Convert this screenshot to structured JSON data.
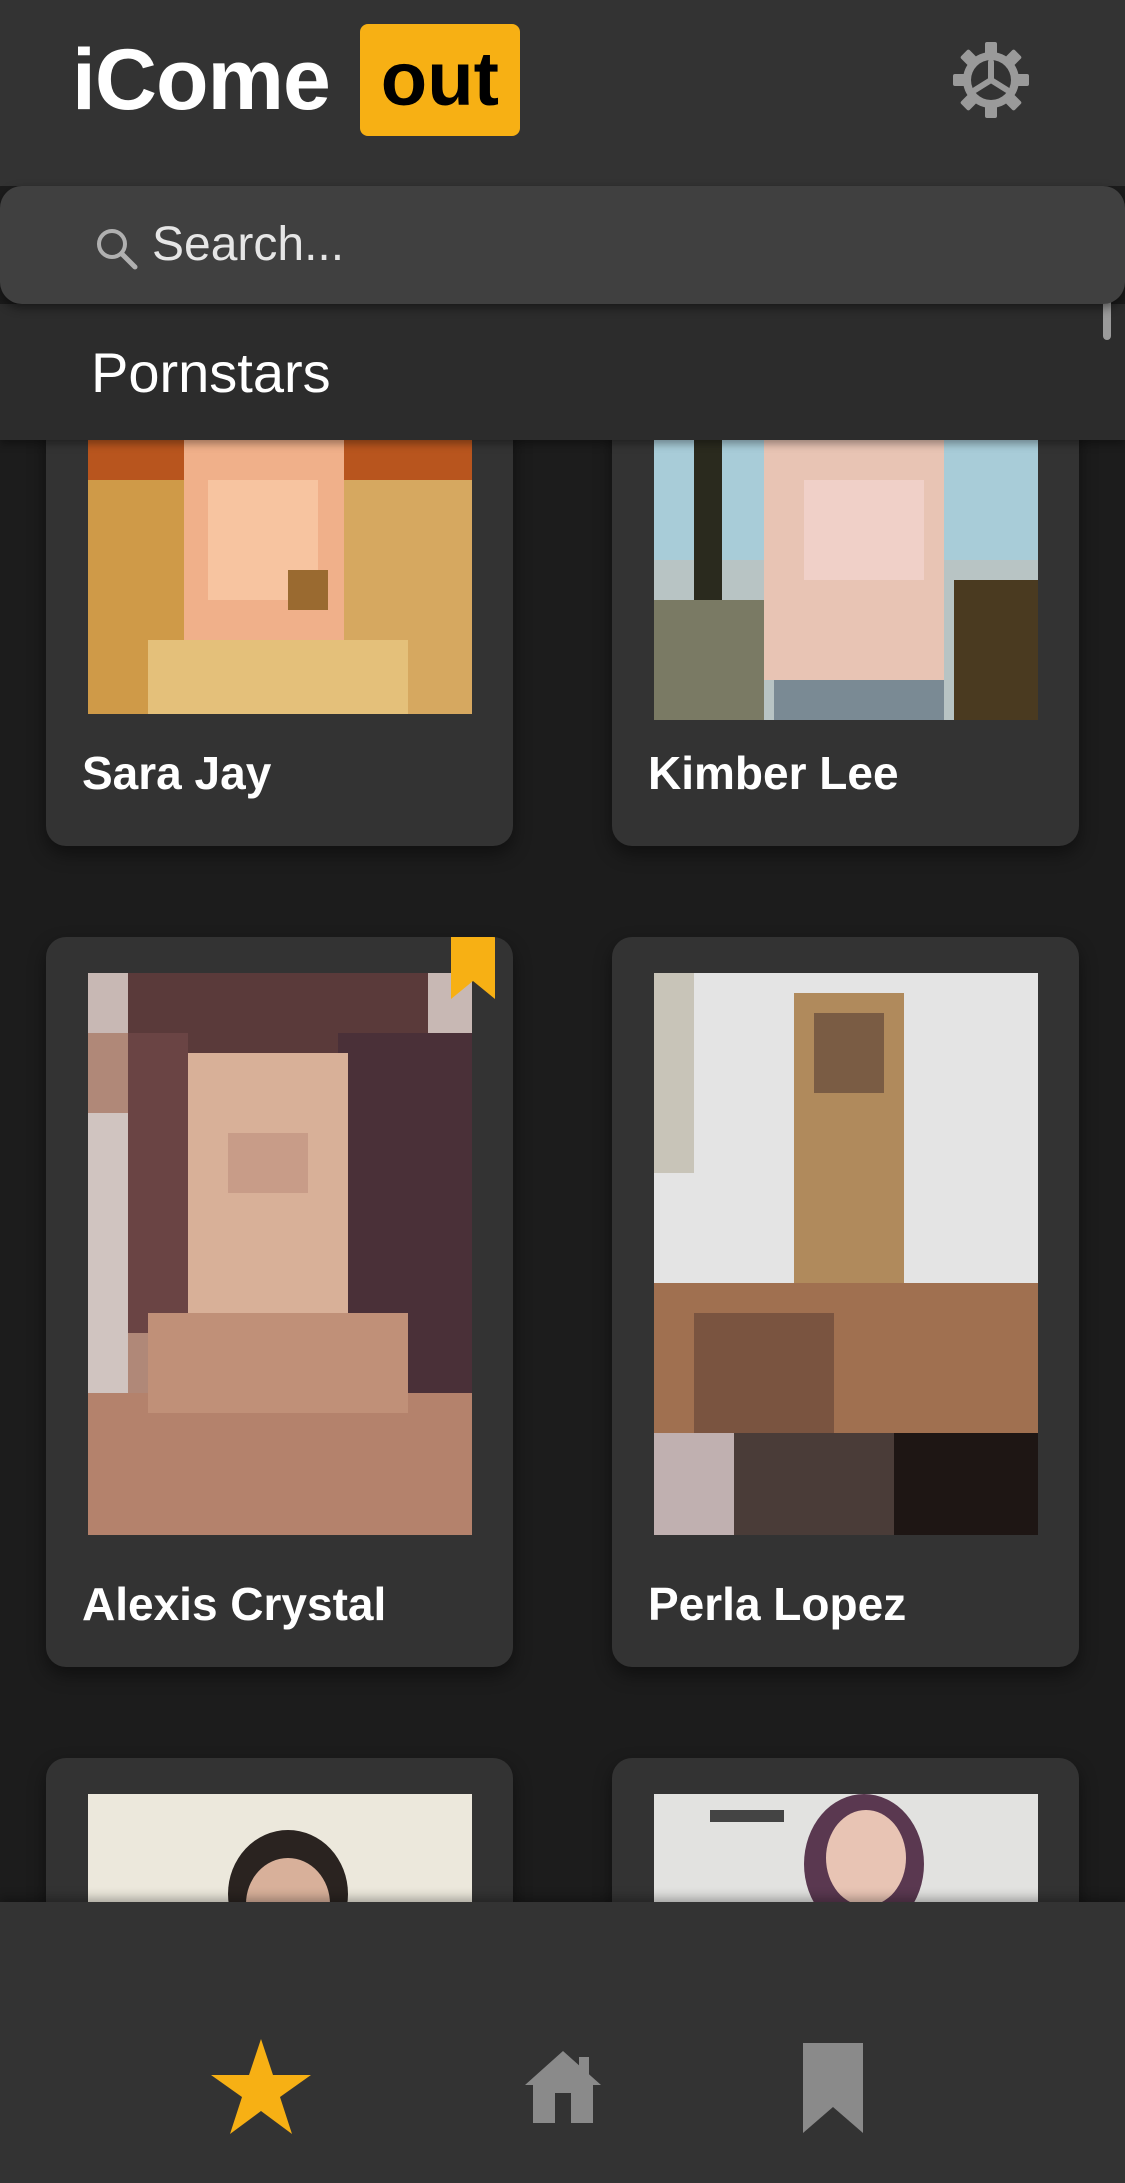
{
  "header": {
    "logo_left": "iCome",
    "logo_right": "out",
    "settings_icon": "gear-icon"
  },
  "search": {
    "placeholder": "Search...",
    "icon": "search-icon"
  },
  "section": {
    "title": "Pornstars"
  },
  "performers": [
    {
      "name": "Sara Jay",
      "bookmarked": false
    },
    {
      "name": "Kimber Lee",
      "bookmarked": false
    },
    {
      "name": "Alexis Crystal",
      "bookmarked": true
    },
    {
      "name": "Perla Lopez",
      "bookmarked": false
    },
    {
      "name": "",
      "bookmarked": false
    },
    {
      "name": "",
      "bookmarked": false
    }
  ],
  "tabbar": {
    "items": [
      {
        "icon": "star-icon",
        "active": true
      },
      {
        "icon": "home-icon",
        "active": false
      },
      {
        "icon": "bookmark-icon",
        "active": false
      }
    ]
  },
  "colors": {
    "accent": "#f7b014",
    "background": "#1c1c1c",
    "surface": "#333333",
    "inactive_icon": "#8a8a8a"
  }
}
